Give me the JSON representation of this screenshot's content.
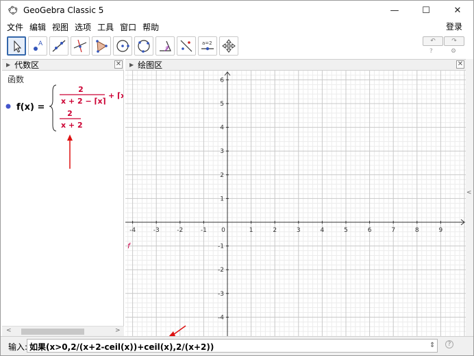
{
  "window": {
    "title": "GeoGebra Classic 5",
    "minimize": "—",
    "maximize": "☐",
    "close": "✕"
  },
  "menu": {
    "items": [
      "文件",
      "编辑",
      "视图",
      "选项",
      "工具",
      "窗口",
      "帮助"
    ],
    "login": "登录"
  },
  "toolbar": {
    "undo_icon": "undo-icon",
    "redo_icon": "redo-icon",
    "help_icon": "help-icon",
    "settings_icon": "gear-icon",
    "slider_label": "a=2"
  },
  "algebra": {
    "header": "代数区",
    "category": "函数",
    "function_name": "f(x) =",
    "piece1": {
      "numerator": "2",
      "denominator": "x + 2 − ⌈x⌉",
      "suffix": "+ ⌈x"
    },
    "piece2": {
      "numerator": "2",
      "denominator": "x + 2"
    },
    "point_color": "#4455cc",
    "formula_color": "#cc0033",
    "arrow_color": "#dd1111"
  },
  "graphics": {
    "header": "绘图区",
    "curve_label": "f",
    "curve_color": "#cc1155",
    "x_tick_labels": [
      "-4",
      "-3",
      "-2",
      "-1",
      "0",
      "1",
      "2",
      "3",
      "4",
      "5",
      "6",
      "7",
      "8",
      "9"
    ],
    "y_tick_labels": [
      "6",
      "5",
      "4",
      "3",
      "2",
      "1",
      "-1",
      "-2",
      "-3",
      "-4"
    ],
    "function": {
      "expression": "If(x>0, 2/(x+2-ceil(x))+ceil(x), 2/(x+2))"
    }
  },
  "input": {
    "label": "输入:",
    "value": "如果(x>0,2/(x+2-ceil(x))+ceil(x),2/(x+2))",
    "spinner": "⇕",
    "help": "?"
  }
}
